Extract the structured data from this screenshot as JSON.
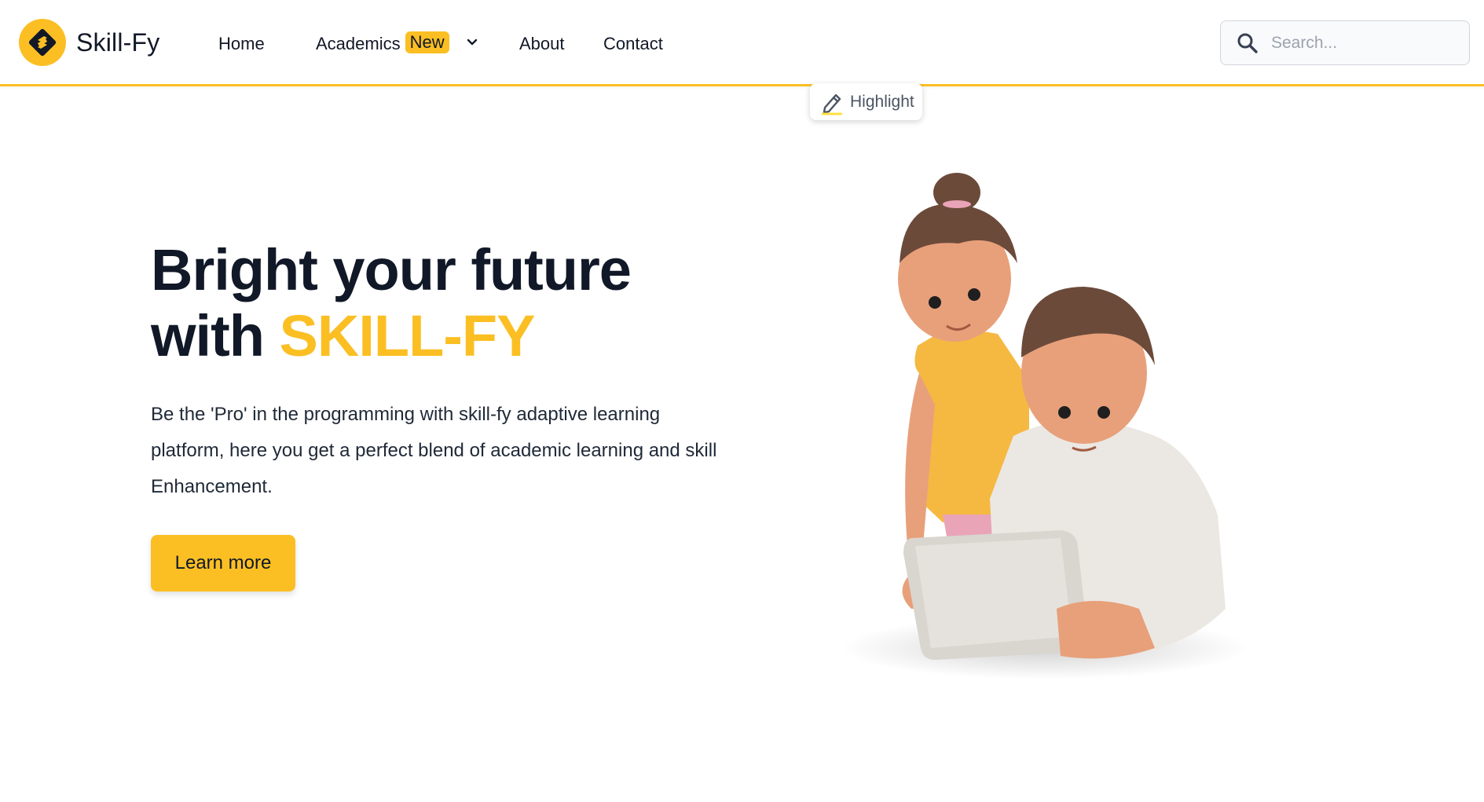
{
  "brand": {
    "name": "Skill-Fy",
    "logo_icon": "skillfy-logo-icon",
    "accent": "#fbbf24"
  },
  "nav": {
    "home": "Home",
    "academics": "Academics",
    "academics_badge": "New",
    "dropdown_icon": "chevron-down-icon",
    "about": "About",
    "contact": "Contact"
  },
  "search": {
    "placeholder": "Search...",
    "value": "",
    "icon": "search-icon"
  },
  "highlight": {
    "label": "Highlight",
    "icon": "pen-icon"
  },
  "hero": {
    "title_line1": "Bright your future",
    "title_line2_prefix": "with ",
    "title_line2_accent": "SKILL-FY",
    "description": "Be the 'Pro' in the programming with skill-fy adaptive learning platform, here you get a perfect blend of academic learning and skill Enhancement.",
    "cta_label": "Learn more",
    "text_color": "#111827"
  }
}
